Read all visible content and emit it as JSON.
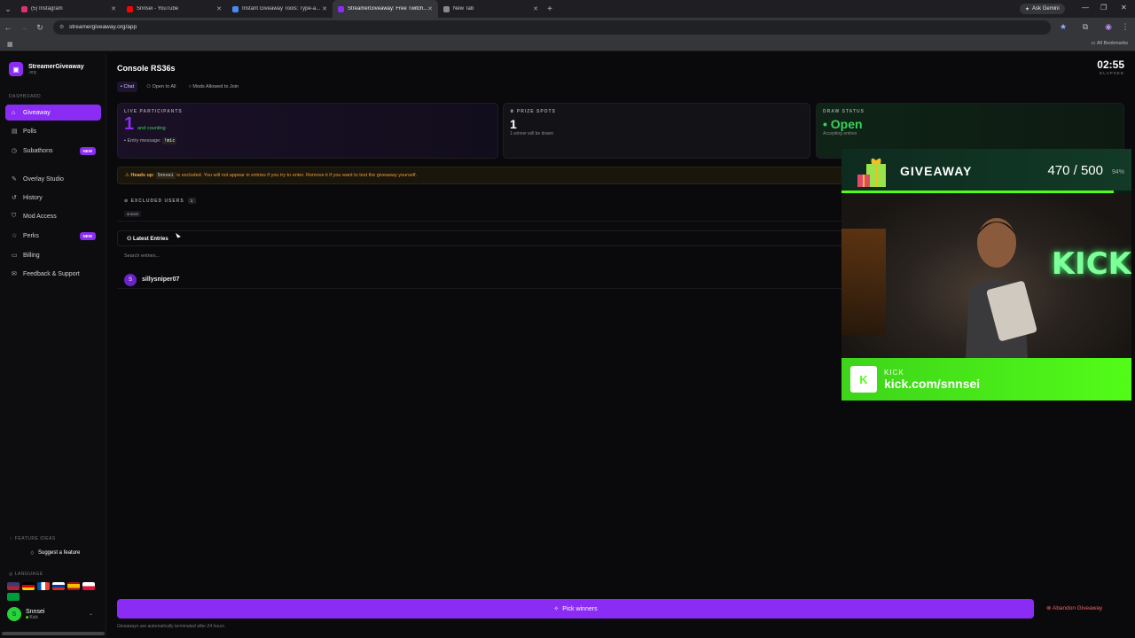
{
  "browser": {
    "tabs": [
      {
        "label": "(5) Instagram",
        "color": "#e1306c"
      },
      {
        "label": "Snnsei - YouTube",
        "color": "#ff0000"
      },
      {
        "label": "Instant Giveaway Tools: Type-a...",
        "color": "#4a8af4"
      },
      {
        "label": "StreamerGiveaway: Free Twitch...",
        "color": "#8b2cf5"
      },
      {
        "label": "New Tab",
        "color": "#888888"
      }
    ],
    "gemini_label": "Ask Gemini",
    "url": "streamergiveaway.org/app",
    "all_bookmarks": "All Bookmarks"
  },
  "sidebar": {
    "brand_name": "StreamerGiveaway",
    "brand_sub": ".org",
    "section_label": "DASHBOARD",
    "items": [
      {
        "label": "Giveaway",
        "icon": "gift-icon",
        "glyph": "⌂"
      },
      {
        "label": "Polls",
        "icon": "poll-icon",
        "glyph": "▤"
      },
      {
        "label": "Subathons",
        "icon": "clock-icon",
        "glyph": "◷",
        "badge": "NEW"
      },
      {
        "label": "Overlay Studio",
        "icon": "brush-icon",
        "glyph": "✎"
      },
      {
        "label": "History",
        "icon": "history-icon",
        "glyph": "↺"
      },
      {
        "label": "Mod Access",
        "icon": "shield-icon",
        "glyph": "⛉"
      },
      {
        "label": "Perks",
        "icon": "star-icon",
        "glyph": "☆",
        "badge": "NEW"
      },
      {
        "label": "Billing",
        "icon": "card-icon",
        "glyph": "▭"
      },
      {
        "label": "Feedback & Support",
        "icon": "chat-icon",
        "glyph": "✉"
      }
    ],
    "feature_ideas_label": "FEATURE IDEAS",
    "suggest_label": "Suggest a feature",
    "language_label": "LANGUAGE",
    "user": {
      "name": "Snnsei",
      "platform": "Kick",
      "initial": "S"
    }
  },
  "main": {
    "title": "Console RS36s",
    "chips": [
      "Chat",
      "Open to All",
      "Mods Allowed to Join"
    ],
    "timer": {
      "value": "02:55",
      "label": "ELAPSED"
    },
    "cards": {
      "participants": {
        "label": "LIVE PARTICIPANTS",
        "value": "1",
        "sub": "and counting",
        "entry_label": "Entry message:",
        "entry_code": "!mic"
      },
      "prizes": {
        "label": "PRIZE SPOTS",
        "value": "1",
        "sub": "1 winner will be drawn"
      },
      "status": {
        "label": "DRAW STATUS",
        "value": "Open",
        "sub": "Accepting entries"
      }
    },
    "warning": {
      "bold": "Heads up:",
      "code": "Snnsei",
      "text": "is excluded. You will not appear in entries if you try to enter. Remove it if you want to test the giveaway yourself."
    },
    "excluded": {
      "label": "EXCLUDED USERS",
      "count": "1",
      "user": "snnsei"
    },
    "entries_header": "Latest Entries",
    "search_placeholder": "Search entries...",
    "entries": [
      {
        "initial": "S",
        "name": "sillysniper07"
      }
    ],
    "pick_label": "Pick winners",
    "abandon_label": "Abandon Giveaway",
    "footer_note": "Giveaways are automatically terminated after 24 hours."
  },
  "overlay": {
    "title": "GIVEAWAY",
    "count": "470 / 500",
    "percent": "94%",
    "progress": 0.94,
    "neon_text": "KICK",
    "platform": "KICK",
    "channel_url": "kick.com/snnsei"
  }
}
